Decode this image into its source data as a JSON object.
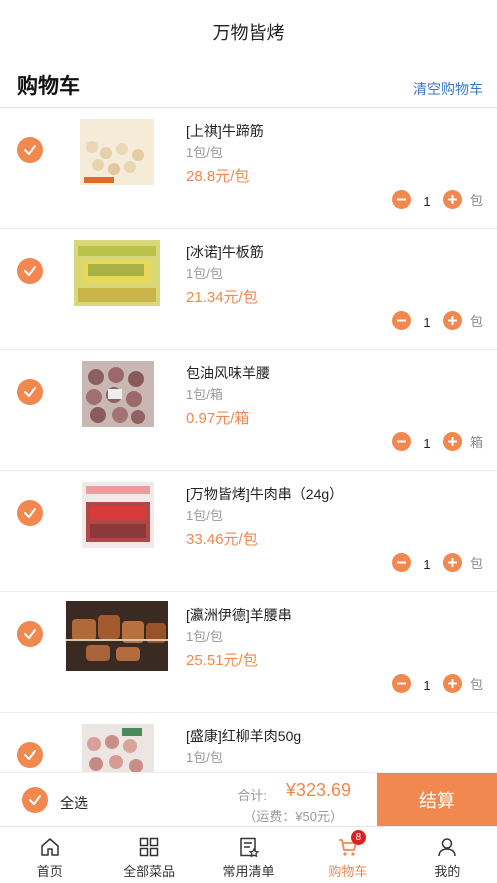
{
  "app": {
    "title": "万物皆烤"
  },
  "header": {
    "title": "购物车",
    "clear_label": "清空购物车"
  },
  "items": [
    {
      "name": "[上祺]牛蹄筋",
      "spec": "1包/包",
      "price": "28.8元/包",
      "qty": "1",
      "unit": "包",
      "checked": true
    },
    {
      "name": "[冰诺]牛板筋",
      "spec": "1包/包",
      "price": "21.34元/包",
      "qty": "1",
      "unit": "包",
      "checked": true
    },
    {
      "name": "包油风味羊腰",
      "spec": "1包/箱",
      "price": "0.97元/箱",
      "qty": "1",
      "unit": "箱",
      "checked": true
    },
    {
      "name": "[万物皆烤]牛肉串（24g）",
      "spec": "1包/包",
      "price": "33.46元/包",
      "qty": "1",
      "unit": "包",
      "checked": true
    },
    {
      "name": "[瀛洲伊德]羊腰串",
      "spec": "1包/包",
      "price": "25.51元/包",
      "qty": "1",
      "unit": "包",
      "checked": true
    },
    {
      "name": "[盛康]红柳羊肉50g",
      "spec": "1包/包",
      "price": "",
      "qty": "",
      "unit": "",
      "checked": true
    }
  ],
  "footer": {
    "select_all_label": "全选",
    "total_label": "合计:",
    "total_value": "¥323.69",
    "freight": "（运费：¥50元）",
    "checkout_label": "结算"
  },
  "tabbar": [
    {
      "label": "首页",
      "icon": "home-icon",
      "active": false
    },
    {
      "label": "全部菜品",
      "icon": "grid-icon",
      "active": false
    },
    {
      "label": "常用清单",
      "icon": "list-star-icon",
      "active": false
    },
    {
      "label": "购物车",
      "icon": "cart-icon",
      "active": true,
      "badge": "8"
    },
    {
      "label": "我的",
      "icon": "user-icon",
      "active": false
    }
  ],
  "colors": {
    "accent": "#f0884f",
    "link": "#3a78c9",
    "badge": "#e02020"
  }
}
